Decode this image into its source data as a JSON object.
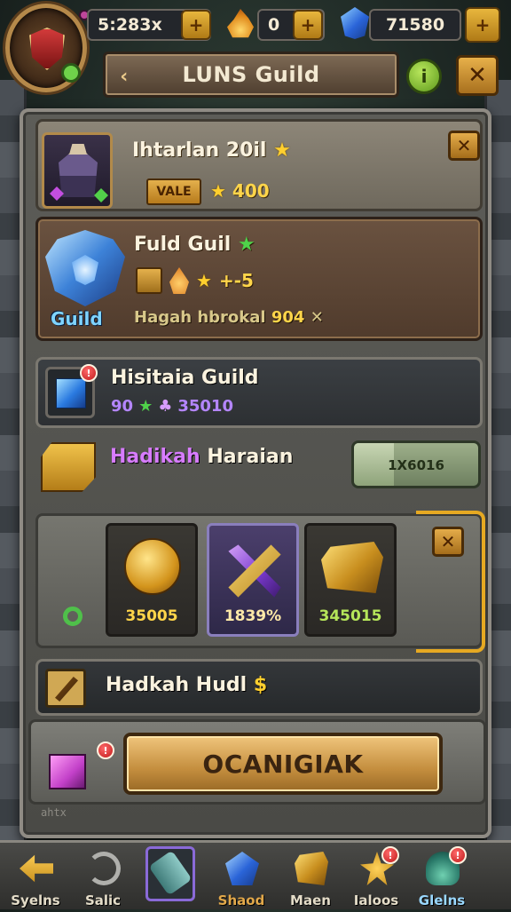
{
  "topbar": {
    "level_badge": "",
    "resource_1": {
      "label": "5:283x",
      "button": "+"
    },
    "resource_2": {
      "value": "0",
      "button": "+"
    },
    "resource_3": {
      "value": "71580",
      "button": "+"
    },
    "title": "LUNS Guild",
    "title_left_icon": "‹",
    "info_icon": "i",
    "close_icon": "✕"
  },
  "hero_card": {
    "name": "Ihtarlan 20il",
    "star": "★",
    "tag": "VALE",
    "stat_star": "★",
    "stat_value": "400",
    "close": "✕"
  },
  "guild_card": {
    "crest_label": "Guild",
    "title": "Fuld Guil",
    "title_leaf": "★",
    "bonus_star": "★",
    "bonus_value": "+-5",
    "motto_text": "Hagah hbrokal",
    "motto_number": "904",
    "motto_sym": "✕"
  },
  "shop_card": {
    "title": "Hisitaia Guild",
    "notif": "!",
    "row_a": "90",
    "row_b": "★",
    "row_c": "♣",
    "count": "35010"
  },
  "quest_row": {
    "title_highlight": "Hadikah",
    "title_rest": "Haraian",
    "progress_text": "1X6016",
    "progress_fraction": 0.32
  },
  "rewards": {
    "close": "✕",
    "items": [
      {
        "label": "35005",
        "color": "#ffd54a"
      },
      {
        "label": "1839%",
        "color": "#ffe9a8"
      },
      {
        "label": "345015",
        "color": "#b6e65a"
      }
    ]
  },
  "hud_card": {
    "title": "Hadkah Hudl",
    "title_sym": "$"
  },
  "action": {
    "notif": "!",
    "button": "OCANIGIAK",
    "footer": "ahtx"
  },
  "bottom_nav": [
    {
      "label": "Syelns",
      "icon": "arrow-icon",
      "color": "#e4dcc8"
    },
    {
      "label": "Salic",
      "icon": "hook-icon",
      "color": "#e4dcc8"
    },
    {
      "label": "",
      "icon": "tube-icon",
      "color": "#e4dcc8",
      "active": true
    },
    {
      "label": "Shaod",
      "icon": "gem-icon",
      "color": "#e2a84a"
    },
    {
      "label": "Maen",
      "icon": "box-icon",
      "color": "#e4dcc8"
    },
    {
      "label": "Ialoos",
      "icon": "burst-icon",
      "color": "#e4dcc8",
      "notif": "!"
    },
    {
      "label": "Glelns",
      "icon": "shell-icon",
      "color": "#9ad8ff",
      "notif": "!"
    }
  ]
}
